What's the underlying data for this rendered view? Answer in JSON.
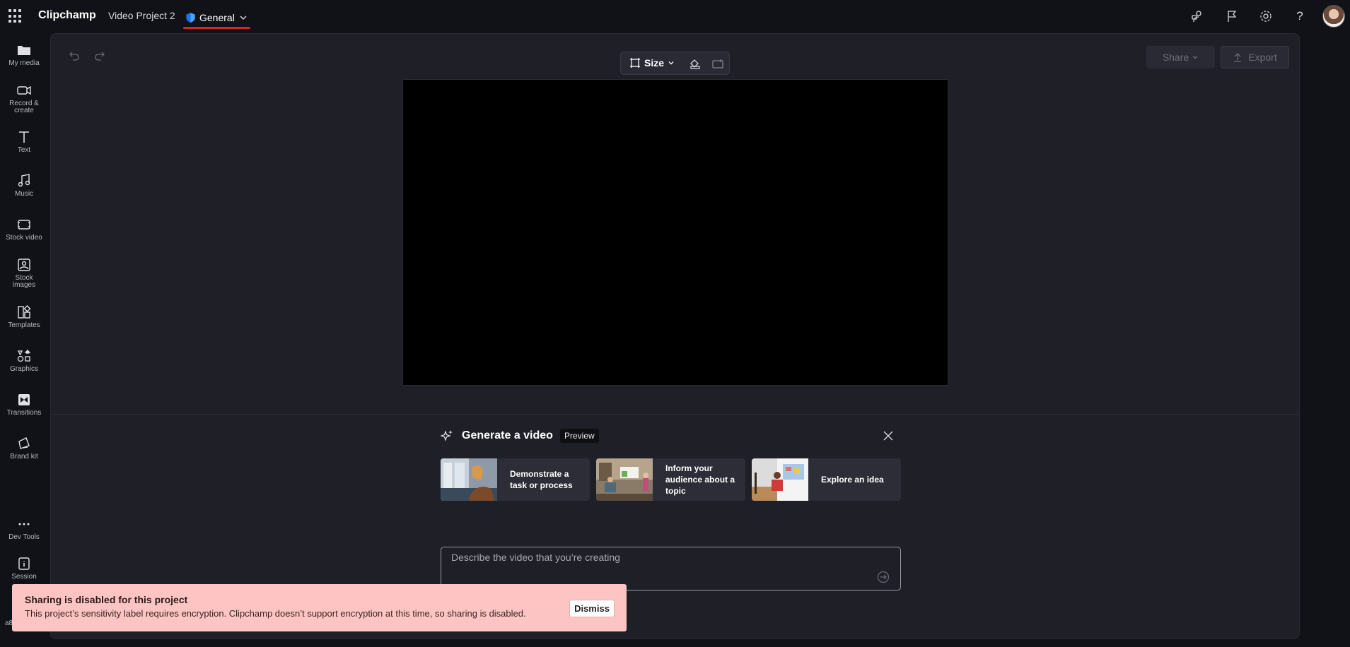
{
  "app": {
    "name": "Clipchamp",
    "project_name": "Video Project 2",
    "sensitivity_label": "General"
  },
  "sidebar": {
    "items": [
      {
        "label": "My media",
        "icon": "folder-icon"
      },
      {
        "label": "Record & create",
        "icon": "camera-icon"
      },
      {
        "label": "Text",
        "icon": "text-icon"
      },
      {
        "label": "Music",
        "icon": "music-icon"
      },
      {
        "label": "Stock video",
        "icon": "film-icon"
      },
      {
        "label": "Stock images",
        "icon": "image-icon"
      },
      {
        "label": "Templates",
        "icon": "templates-icon"
      },
      {
        "label": "Graphics",
        "icon": "shapes-icon"
      },
      {
        "label": "Transitions",
        "icon": "transitions-icon"
      },
      {
        "label": "Brand kit",
        "icon": "brand-kit-icon"
      },
      {
        "label": "Dev Tools",
        "icon": "more-icon"
      },
      {
        "label": "Session",
        "icon": "session-icon"
      }
    ],
    "peek_text": "a8"
  },
  "toolbar": {
    "size_label": "Size",
    "share_label": "Share",
    "export_label": "Export"
  },
  "generate": {
    "title": "Generate a video",
    "tag": "Preview",
    "cards": [
      {
        "text": "Demonstrate a task or process"
      },
      {
        "text": "Inform your audience about a topic"
      },
      {
        "text": "Explore an idea"
      }
    ],
    "prompt_placeholder": "Describe the video that you’re creating"
  },
  "toast": {
    "title": "Sharing is disabled for this project",
    "body": "This project’s sensitivity label requires encryption. Clipchamp doesn’t support encryption at this time, so sharing is disabled.",
    "dismiss_label": "Dismiss"
  },
  "colors": {
    "background": "#111118",
    "panel": "#1f1f28",
    "label_underline": "#d4252b",
    "toast_bg": "#fdc4c4"
  }
}
